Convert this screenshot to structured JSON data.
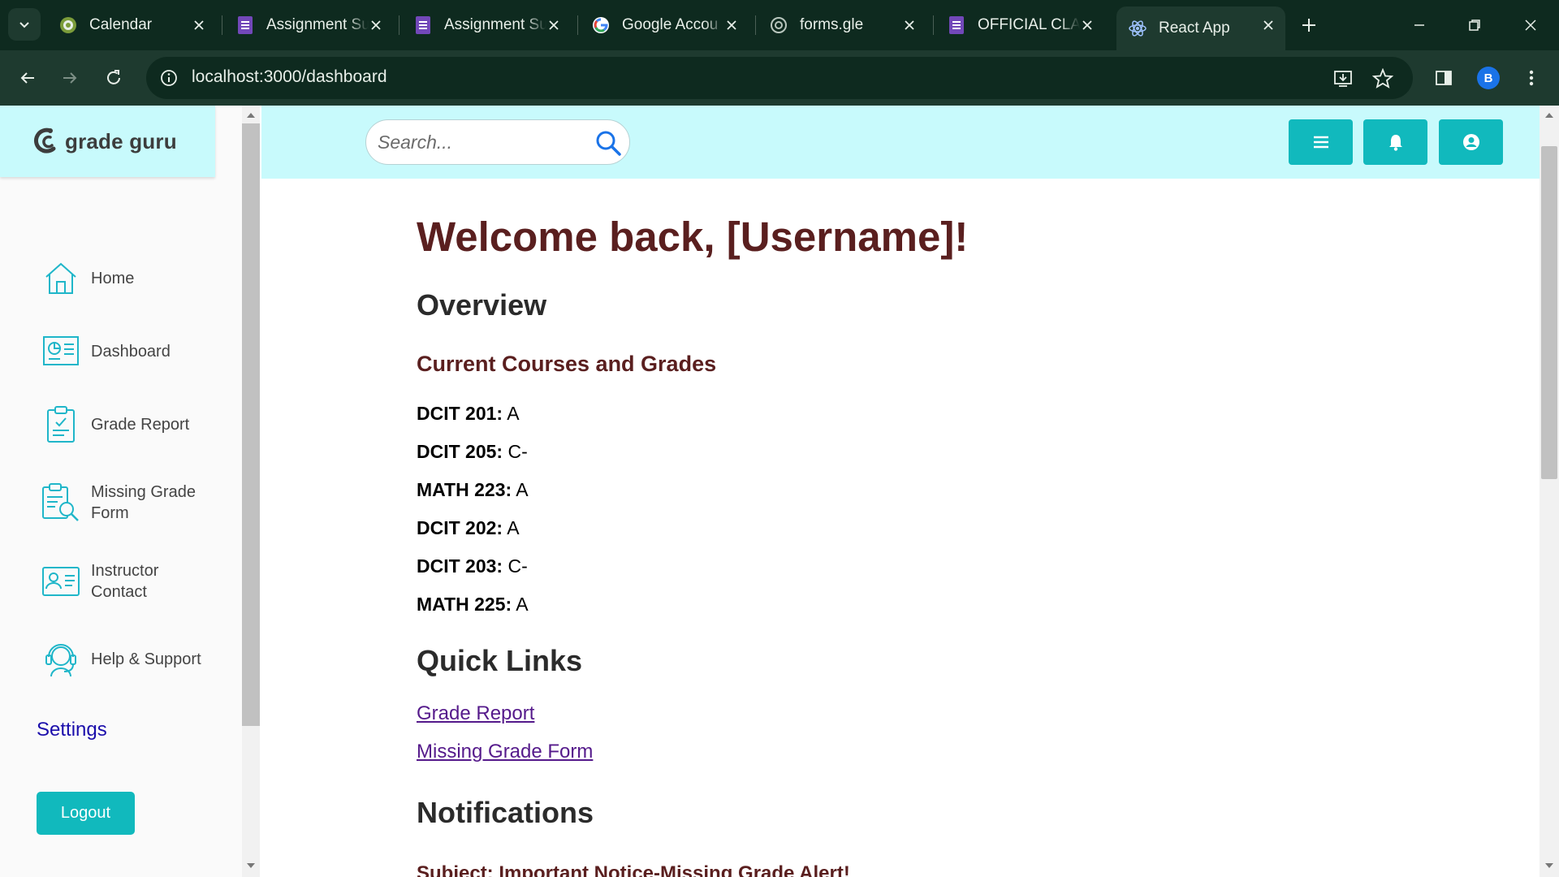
{
  "browser": {
    "tabs": [
      {
        "title": "Calendar",
        "icon": "calendar-favicon"
      },
      {
        "title": "Assignment Su",
        "icon": "forms-favicon"
      },
      {
        "title": "Assignment Su",
        "icon": "forms-favicon"
      },
      {
        "title": "Google Accou",
        "icon": "google-favicon"
      },
      {
        "title": "forms.gle",
        "icon": "globe-favicon"
      },
      {
        "title": "OFFICIAL CLA",
        "icon": "forms-favicon"
      },
      {
        "title": "React App",
        "icon": "react-favicon",
        "active": true
      }
    ],
    "url": "localhost:3000/dashboard",
    "profile_initial": "B"
  },
  "app": {
    "brand": "grade guru",
    "search": {
      "placeholder": "Search..."
    },
    "sidebar": {
      "items": [
        {
          "label": "Home",
          "icon": "home-icon"
        },
        {
          "label": "Dashboard",
          "icon": "dashboard-icon"
        },
        {
          "label": "Grade Report",
          "icon": "clipboard-icon"
        },
        {
          "label": "Missing Grade Form",
          "icon": "search-document-icon"
        },
        {
          "label": "Instructor Contact",
          "icon": "contact-card-icon"
        },
        {
          "label": "Help & Support",
          "icon": "headset-icon"
        }
      ],
      "settings": "Settings",
      "logout": "Logout"
    },
    "header_buttons": [
      "menu-icon",
      "bell-icon",
      "user-icon"
    ],
    "colors": {
      "accent": "#11b9bd",
      "header_bg": "#c8fafc",
      "heading_maroon": "#5a1f1f"
    }
  },
  "dashboard": {
    "welcome": "Welcome back, [Username]!",
    "overview_heading": "Overview",
    "courses_heading": "Current Courses and Grades",
    "courses": [
      {
        "code": "DCIT 201:",
        "grade": "A"
      },
      {
        "code": "DCIT 205:",
        "grade": "C-"
      },
      {
        "code": "MATH 223:",
        "grade": "A"
      },
      {
        "code": "DCIT 202:",
        "grade": "A"
      },
      {
        "code": "DCIT 203:",
        "grade": "C-"
      },
      {
        "code": "MATH 225:",
        "grade": "A"
      }
    ],
    "quick_links_heading": "Quick Links",
    "quick_links": [
      "Grade Report",
      "Missing Grade Form"
    ],
    "notifications_heading": "Notifications",
    "notification_subject": "Subject: Important Notice-Missing Grade Alert!"
  }
}
